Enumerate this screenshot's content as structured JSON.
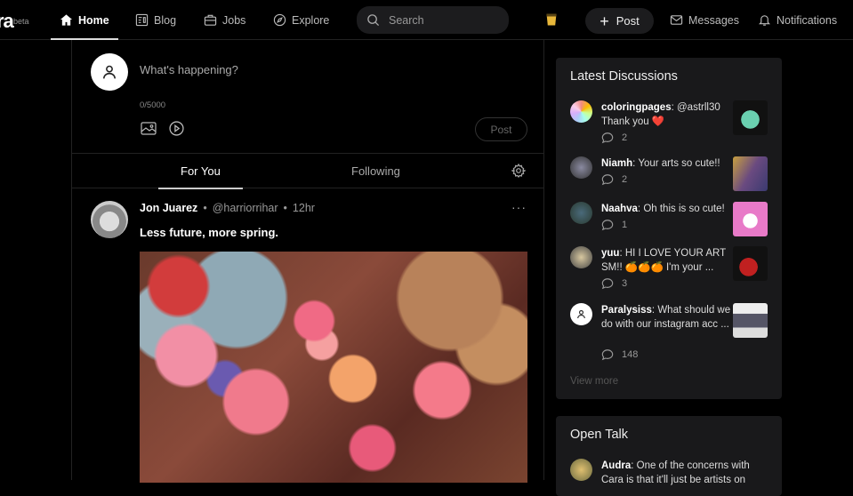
{
  "brand": {
    "logo": "ra",
    "badge": "beta"
  },
  "nav": [
    {
      "label": "Home",
      "icon": "home-icon",
      "active": true
    },
    {
      "label": "Blog",
      "icon": "blog-icon"
    },
    {
      "label": "Jobs",
      "icon": "briefcase-icon"
    },
    {
      "label": "Explore",
      "icon": "compass-icon"
    }
  ],
  "search": {
    "placeholder": "Search"
  },
  "header_actions": {
    "post": "Post",
    "messages": "Messages",
    "notifications": "Notifications",
    "accent": "#e8b73a"
  },
  "composer": {
    "placeholder": "What's happening?",
    "counter": "0/5000",
    "post_label": "Post"
  },
  "tabs": {
    "for_you": "For You",
    "following": "Following"
  },
  "post": {
    "name": "Jon Juarez",
    "handle": "@harriorrihar",
    "time": "12hr",
    "text": "Less future, more spring.",
    "separator": "•",
    "more": "···"
  },
  "latest": {
    "title": "Latest Discussions",
    "items": [
      {
        "user": "coloringpages",
        "text": "@astrll30 Thank you ❤️",
        "comments": "2"
      },
      {
        "user": "Niamh",
        "text": "Your arts so cute!!",
        "comments": "2"
      },
      {
        "user": "Naahva",
        "text": "Oh this is so cute!",
        "comments": "1"
      },
      {
        "user": "yuu",
        "text": "HI I LOVE YOUR ART SM!! 🍊🍊🍊 I'm your ...",
        "comments": "3"
      },
      {
        "user": "Paralysiss",
        "text": "What should we do with our instagram acc ...",
        "comments": "148"
      }
    ],
    "view_more": "View more"
  },
  "open_talk": {
    "title": "Open Talk",
    "items": [
      {
        "user": "Audra",
        "text": "One of the concerns with Cara is that it'll just be artists on"
      }
    ]
  }
}
